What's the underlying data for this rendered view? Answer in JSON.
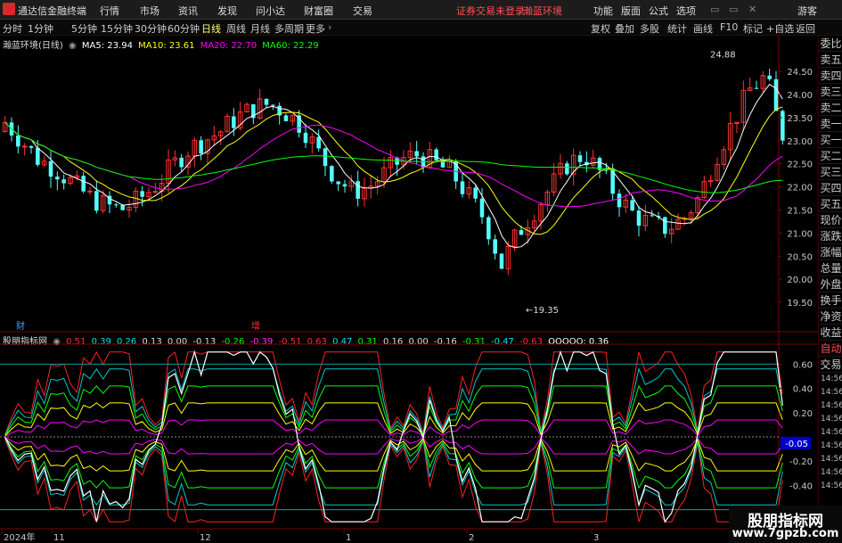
{
  "menubar": {
    "app_title": "通达信金融终端",
    "items": [
      "行情",
      "市场",
      "资讯",
      "发现",
      "问小达",
      "财富圈",
      "交易"
    ],
    "warning": "证券交易未登录",
    "stock_name": "瀚蓝环境",
    "right_items": [
      "功能",
      "版面",
      "公式",
      "选项"
    ],
    "guest": "游客"
  },
  "toolbar": {
    "periods": [
      "分时",
      "1分钟",
      "5分钟",
      "15分钟",
      "30分钟",
      "60分钟",
      "日线",
      "周线",
      "月线",
      "多周期",
      "更多"
    ],
    "active_period": "日线",
    "tools": [
      "复权",
      "叠加",
      "多股",
      "统计",
      "画线",
      "F10",
      "标记",
      "+自选",
      "返回"
    ]
  },
  "main_legend": {
    "title": "瀚蓝环境(日线)",
    "ma5": "MA5: 23.94",
    "ma10": "MA10: 23.61",
    "ma20": "MA20: 22.70",
    "ma60": "MA60: 22.29",
    "colors": {
      "ma5": "#ffffff",
      "ma10": "#ffff00",
      "ma20": "#ff00ff",
      "ma60": "#00ff00"
    }
  },
  "indicator_legend": {
    "title": "股朋指标网",
    "values": [
      "0.51",
      "0.39",
      "0.26",
      "0.13",
      "0.00",
      "-0.13",
      "-0.26",
      "-0.39",
      "-0.51",
      "0.63",
      "0.47",
      "0.31",
      "0.16",
      "0.00",
      "-0.16",
      "-0.31",
      "-0.47",
      "-0.63"
    ],
    "last_label": "OOOOO: 0.36"
  },
  "price_axis": {
    "labels": [
      "24.50",
      "24.00",
      "23.50",
      "23.00",
      "22.50",
      "22.00",
      "21.50",
      "21.00",
      "20.50",
      "20.00",
      "19.50"
    ],
    "high_mark": "24.88",
    "low_mark": "19.35"
  },
  "indicator_axis": {
    "labels": [
      "0.60",
      "0.40",
      "0.20",
      "-0.20",
      "-0.40"
    ],
    "current": "-0.05"
  },
  "event_markers": {
    "cai": "财",
    "zeng": "增"
  },
  "x_axis": {
    "labels": [
      "2024年",
      "11",
      "12",
      "1",
      "2",
      "3"
    ]
  },
  "side_panel": {
    "top_items": [
      "委比",
      "卖五",
      "卖四",
      "卖三",
      "卖二",
      "卖一",
      "买一",
      "买二",
      "买三",
      "买四",
      "买五",
      "现价",
      "涨跌",
      "涨幅",
      "总量",
      "外盘",
      "换手",
      "净资",
      "收益"
    ],
    "auto_label": "自动",
    "trade_label": "交易",
    "times": [
      "14:56",
      "14:56",
      "14:56",
      "14:56",
      "14:56",
      "14:56",
      "14:56",
      "14:56",
      "14:56"
    ]
  },
  "watermark": {
    "line1": "股朋指标网",
    "line2": "www.7gpzb.com"
  },
  "chart_data": {
    "type": "candlestick",
    "days": 120,
    "start_open": 23.2,
    "ylim": [
      19.25,
      24.85
    ],
    "extreme_high": 24.88,
    "extreme_low": 19.35,
    "ohlc_trend": [
      23.4,
      23.0,
      22.6,
      22.4,
      22.1,
      21.8,
      21.6,
      21.5,
      21.7,
      22.0,
      22.4,
      22.8,
      23.0,
      23.2,
      23.5,
      23.7,
      23.8,
      23.6,
      23.3,
      22.7,
      22.2,
      21.9,
      22.0,
      22.3,
      22.6,
      22.7,
      22.5,
      22.3,
      21.8,
      21.3,
      20.3,
      21.0,
      21.5,
      22.0,
      22.5,
      22.7,
      22.3,
      21.8,
      21.4,
      21.2,
      21.1,
      21.3,
      21.8,
      22.7,
      23.4,
      24.1,
      24.4,
      23.0
    ],
    "indicator_type": "line",
    "indicator_ylim": [
      -0.75,
      0.75
    ]
  }
}
